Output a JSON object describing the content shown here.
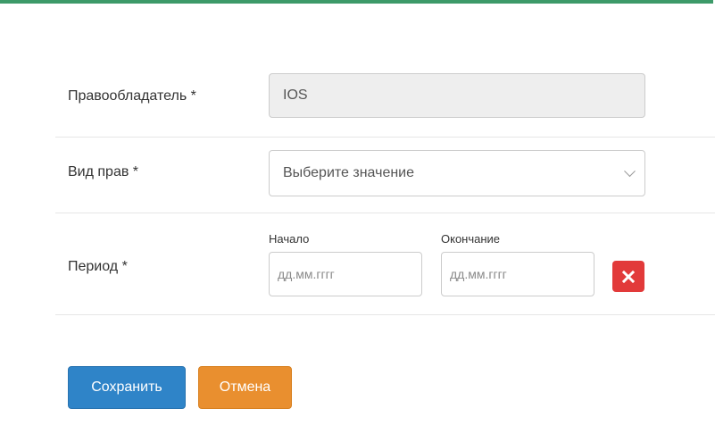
{
  "form": {
    "rightsholder": {
      "label": "Правообладатель *",
      "value": "IOS"
    },
    "rights_type": {
      "label": "Вид прав *",
      "placeholder": "Выберите значение"
    },
    "period": {
      "label": "Период *",
      "start_label": "Начало",
      "end_label": "Окончание",
      "start_placeholder": "дд.мм.гггг",
      "end_placeholder": "дд.мм.гггг"
    }
  },
  "actions": {
    "save_label": "Сохранить",
    "cancel_label": "Отмена"
  },
  "colors": {
    "accent_bar": "#3d9a69",
    "save": "#2f84c8",
    "cancel": "#e98f2f",
    "danger": "#e23a3a"
  },
  "icons": {
    "clear": "close-icon",
    "select": "chevron-down-icon"
  }
}
